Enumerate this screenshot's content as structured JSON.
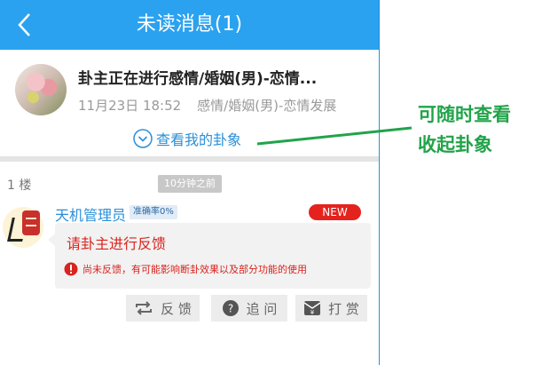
{
  "header": {
    "title": "未读消息(1)"
  },
  "post": {
    "title": "卦主正在进行感情/婚姻(男)-恋情...",
    "date": "11月23日 18:52",
    "category": "感情/婚姻(男)-恋情发展",
    "view_gua_label": "查看我的卦象"
  },
  "reply": {
    "floor": "1 楼",
    "time_ago": "10分钟之前",
    "user_name": "天机管理员",
    "accuracy": "准确率0%",
    "new_badge": "NEW",
    "feedback_title": "请卦主进行反馈",
    "warning": "尚未反馈，有可能影响断卦效果以及部分功能的使用"
  },
  "actions": {
    "feedback": "反 馈",
    "ask": "追 问",
    "reward": "打 赏"
  },
  "annotation": {
    "line1": "可随时查看",
    "line2": "收起卦象"
  },
  "colors": {
    "titlebar": "#2aa2f0",
    "link": "#2a8fd8",
    "alert_red": "#d9231d",
    "new_badge": "#e4231e",
    "annotation_green": "#22a34a"
  }
}
